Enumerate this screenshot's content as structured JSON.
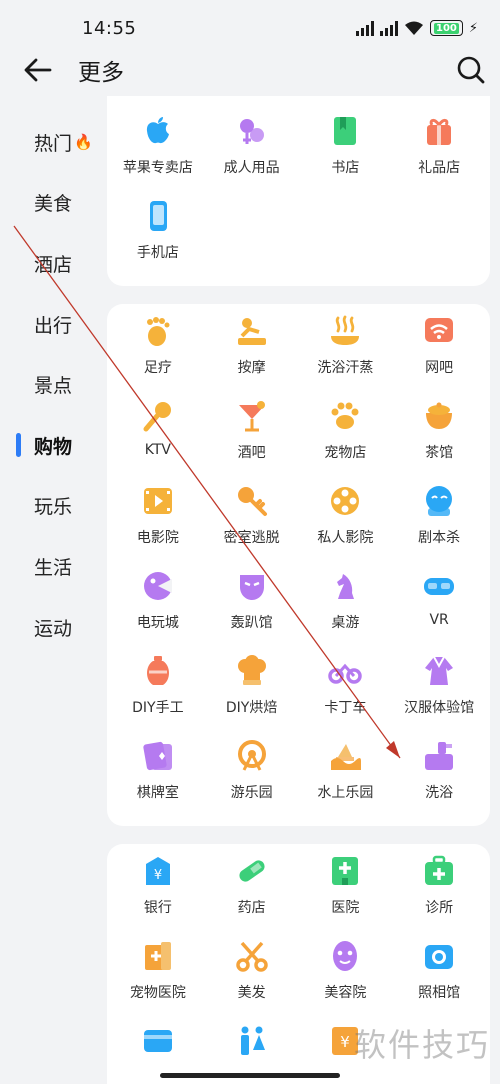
{
  "status": {
    "time": "14:55",
    "battery": "100"
  },
  "header": {
    "title": "更多"
  },
  "sidebar": {
    "items": [
      {
        "label": "热门",
        "hot": true
      },
      {
        "label": "美食"
      },
      {
        "label": "酒店"
      },
      {
        "label": "出行"
      },
      {
        "label": "景点"
      },
      {
        "label": "购物",
        "active": true
      },
      {
        "label": "玩乐"
      },
      {
        "label": "生活"
      },
      {
        "label": "运动"
      }
    ]
  },
  "sections": [
    {
      "items": [
        {
          "label": "苹果专卖店",
          "icon": "apple-icon",
          "color": "#2aa7f5"
        },
        {
          "label": "成人用品",
          "icon": "gender-icon",
          "color": "#b57af0"
        },
        {
          "label": "书店",
          "icon": "book-icon",
          "color": "#3ccf7a"
        },
        {
          "label": "礼品店",
          "icon": "gift-icon",
          "color": "#f57a5b"
        },
        {
          "label": "手机店",
          "icon": "phone-icon",
          "color": "#2aa7f5"
        }
      ]
    },
    {
      "items": [
        {
          "label": "足疗",
          "icon": "foot-icon",
          "color": "#f5b23a"
        },
        {
          "label": "按摩",
          "icon": "massage-icon",
          "color": "#f5b23a"
        },
        {
          "label": "洗浴汗蒸",
          "icon": "steam-icon",
          "color": "#f5b23a"
        },
        {
          "label": "网吧",
          "icon": "wifi-icon",
          "color": "#f57a5b"
        },
        {
          "label": "KTV",
          "icon": "microphone-icon",
          "color": "#f5b23a"
        },
        {
          "label": "酒吧",
          "icon": "cocktail-icon",
          "color": "#f57a5b"
        },
        {
          "label": "宠物店",
          "icon": "paw-icon",
          "color": "#f5b23a"
        },
        {
          "label": "茶馆",
          "icon": "tea-icon",
          "color": "#f5a33a"
        },
        {
          "label": "电影院",
          "icon": "film-icon",
          "color": "#f5b23a"
        },
        {
          "label": "密室逃脱",
          "icon": "key-icon",
          "color": "#f5a33a"
        },
        {
          "label": "私人影院",
          "icon": "film-reel-icon",
          "color": "#f5b23a"
        },
        {
          "label": "剧本杀",
          "icon": "mask-icon",
          "color": "#2aa7f5"
        },
        {
          "label": "电玩城",
          "icon": "game-icon",
          "color": "#b57af0"
        },
        {
          "label": "轰趴馆",
          "icon": "party-mask-icon",
          "color": "#b57af0"
        },
        {
          "label": "桌游",
          "icon": "chess-icon",
          "color": "#b57af0"
        },
        {
          "label": "VR",
          "icon": "vr-icon",
          "color": "#2aa7f5"
        },
        {
          "label": "DIY手工",
          "icon": "vase-icon",
          "color": "#f57a5b"
        },
        {
          "label": "DIY烘焙",
          "icon": "chef-hat-icon",
          "color": "#f5a33a"
        },
        {
          "label": "卡丁车",
          "icon": "kart-icon",
          "color": "#b57af0"
        },
        {
          "label": "汉服体验馆",
          "icon": "hanfu-icon",
          "color": "#b57af0"
        },
        {
          "label": "棋牌室",
          "icon": "cards-icon",
          "color": "#b57af0"
        },
        {
          "label": "游乐园",
          "icon": "ferris-icon",
          "color": "#f5a33a"
        },
        {
          "label": "水上乐园",
          "icon": "wave-icon",
          "color": "#f5a33a"
        },
        {
          "label": "洗浴",
          "icon": "bath-icon",
          "color": "#b57af0"
        }
      ]
    },
    {
      "items": [
        {
          "label": "银行",
          "icon": "bank-icon",
          "color": "#2aa7f5"
        },
        {
          "label": "药店",
          "icon": "pill-icon",
          "color": "#3ccf7a"
        },
        {
          "label": "医院",
          "icon": "hospital-icon",
          "color": "#3ccf7a"
        },
        {
          "label": "诊所",
          "icon": "medkit-icon",
          "color": "#3ccf7a"
        },
        {
          "label": "宠物医院",
          "icon": "pet-hospital-icon",
          "color": "#f5a33a"
        },
        {
          "label": "美发",
          "icon": "scissors-icon",
          "color": "#f5a33a"
        },
        {
          "label": "美容院",
          "icon": "face-icon",
          "color": "#b57af0"
        },
        {
          "label": "照相馆",
          "icon": "camera-icon",
          "color": "#2aa7f5"
        },
        {
          "label": "",
          "icon": "card-icon",
          "color": "#2aa7f5"
        },
        {
          "label": "",
          "icon": "toilet-icon",
          "color": "#2aa7f5"
        },
        {
          "label": "",
          "icon": "yen-icon",
          "color": "#f5a33a"
        }
      ]
    }
  ],
  "watermark": "软件技巧"
}
